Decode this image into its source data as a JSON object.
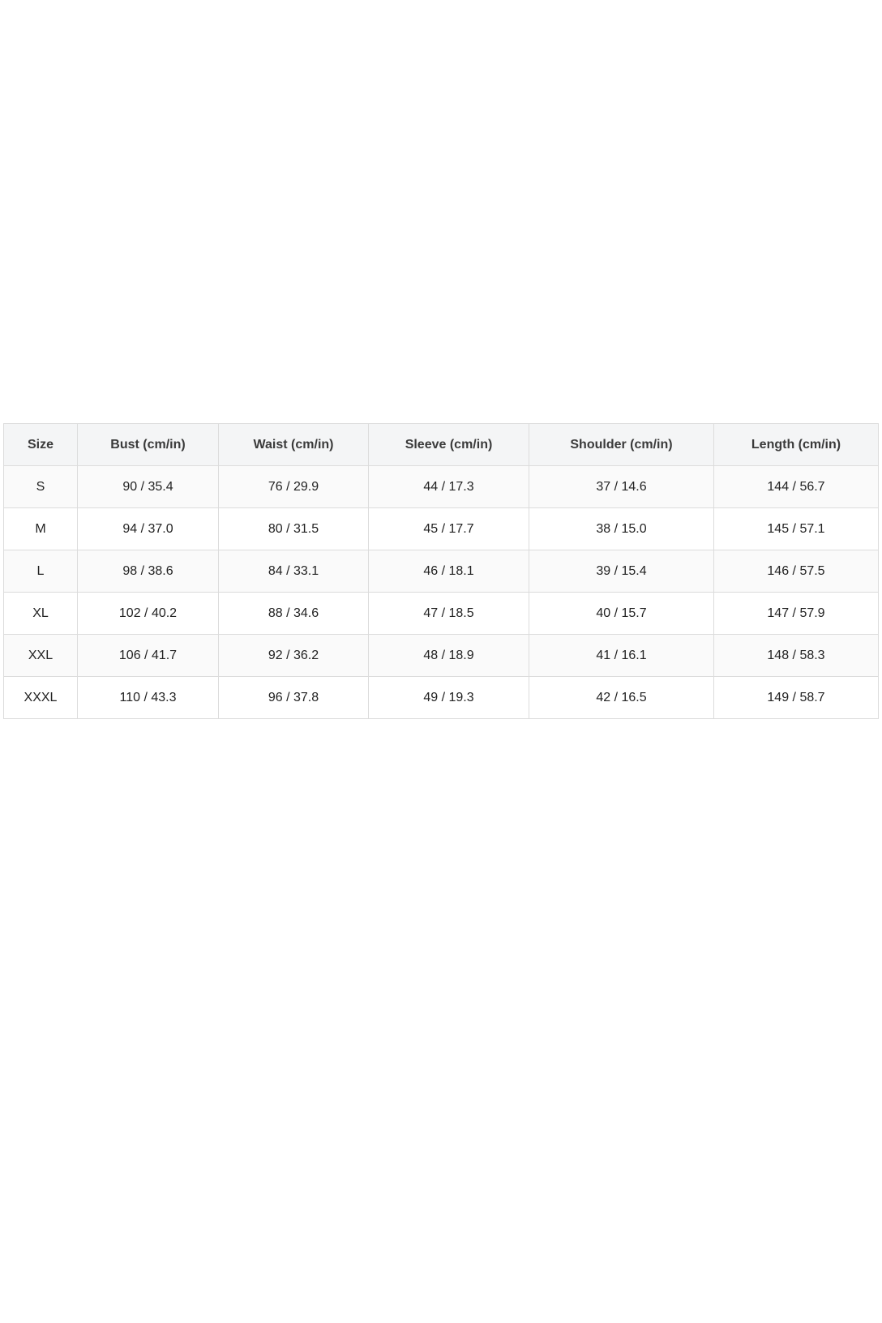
{
  "table": {
    "headers": [
      "Size",
      "Bust (cm/in)",
      "Waist (cm/in)",
      "Sleeve (cm/in)",
      "Shoulder (cm/in)",
      "Length (cm/in)"
    ],
    "rows": [
      [
        "S",
        "90 / 35.4",
        "76 / 29.9",
        "44 / 17.3",
        "37 / 14.6",
        "144 / 56.7"
      ],
      [
        "M",
        "94 / 37.0",
        "80 / 31.5",
        "45 / 17.7",
        "38 / 15.0",
        "145 / 57.1"
      ],
      [
        "L",
        "98 / 38.6",
        "84 / 33.1",
        "46 / 18.1",
        "39 / 15.4",
        "146 / 57.5"
      ],
      [
        "XL",
        "102 / 40.2",
        "88 / 34.6",
        "47 / 18.5",
        "40 / 15.7",
        "147 / 57.9"
      ],
      [
        "XXL",
        "106 / 41.7",
        "92 / 36.2",
        "48 / 18.9",
        "41 / 16.1",
        "148 / 58.3"
      ],
      [
        "XXXL",
        "110 / 43.3",
        "96 / 37.8",
        "49 / 19.3",
        "42 / 16.5",
        "149 / 58.7"
      ]
    ]
  }
}
